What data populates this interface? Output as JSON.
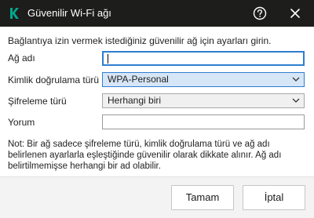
{
  "window": {
    "title": "Güvenilir Wi-Fi ağı",
    "logo_icon": "kaspersky-k-logo",
    "help_icon": "question-circle-icon",
    "close_icon": "close-x-icon",
    "titlebar_color": "#1d1d1b",
    "logo_color": "#00a88e"
  },
  "form": {
    "intro": "Bağlantıya izin vermek istediğiniz güvenilir ağ için ayarları girin.",
    "network_name": {
      "label": "Ağ adı",
      "value": ""
    },
    "auth_type": {
      "label": "Kimlik doğrulama türü",
      "selected": "WPA-Personal"
    },
    "encryption_type": {
      "label": "Şifreleme türü",
      "selected": "Herhangi biri"
    },
    "comment": {
      "label": "Yorum",
      "value": ""
    },
    "note": "Not: Bir ağ sadece şifreleme türü, kimlik doğrulama türü ve ağ adı belirlenen ayarlarla eşleştiğinde güvenilir olarak dikkate alınır. Ağ adı belirtilmemişse herhangi bir ad olabilir."
  },
  "footer": {
    "ok_label": "Tamam",
    "cancel_label": "İptal"
  }
}
